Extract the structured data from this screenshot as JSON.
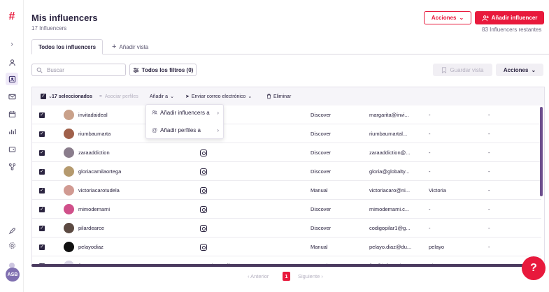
{
  "app": {
    "logo": "#"
  },
  "header": {
    "title": "Mis influencers",
    "count": "17 Influencers",
    "actions_label": "Acciones",
    "add_label": "Añadir influencer",
    "remaining": "83 Influencers restantes"
  },
  "tabs": {
    "active": "Todos los influencers",
    "add_view": "Añadir vista"
  },
  "toolbar": {
    "search_placeholder": "Buscar",
    "filters_label": "Todos los filtros (0)",
    "save_view_label": "Guardar vista",
    "actions_label": "Acciones"
  },
  "bulk": {
    "selected": "17 seleccionados",
    "associate": "Asociar perfiles",
    "add_to": "Añadir a",
    "send_email": "Enviar correo electrónico",
    "delete": "Eliminar"
  },
  "dropdown": {
    "items": [
      "Añadir influencers a",
      "Añadir perfiles a"
    ]
  },
  "rows": [
    {
      "name": "invitadaideal",
      "source": "Discover",
      "email": "margarita@invi...",
      "col6": "-",
      "col7": "-",
      "network": "none",
      "avatar": "#c9a18a"
    },
    {
      "name": "riumbaumarta",
      "source": "Discover",
      "email": "riumbaumartal...",
      "col6": "-",
      "col7": "-",
      "network": "none",
      "avatar": "#a0604a"
    },
    {
      "name": "zaraaddiction",
      "source": "Discover",
      "email": "zaraaddiction@...",
      "col6": "-",
      "col7": "-",
      "network": "instagram",
      "avatar": "#8a7d8c"
    },
    {
      "name": "gloriacamilaortega",
      "source": "Discover",
      "email": "gloria@globalty...",
      "col6": "-",
      "col7": "-",
      "network": "instagram",
      "avatar": "#b59a6e"
    },
    {
      "name": "victoriacarotudela",
      "source": "Manual",
      "email": "victoriacaro@ni...",
      "col6": "Victoria",
      "col7": "-",
      "network": "instagram",
      "avatar": "#d19a92"
    },
    {
      "name": "mimodemami",
      "source": "Discover",
      "email": "mimodemami.c...",
      "col6": "-",
      "col7": "-",
      "network": "instagram",
      "avatar": "#d0508a"
    },
    {
      "name": "pilardearce",
      "source": "Discover",
      "email": "codigopilar1@g...",
      "col6": "-",
      "col7": "-",
      "network": "instagram",
      "avatar": "#5c4a42"
    },
    {
      "name": "pelayodiaz",
      "source": "Manual",
      "email": "pelayo.diaz@du...",
      "col6": "pelayo",
      "col7": "-",
      "network": "instagram",
      "avatar": "#111111"
    },
    {
      "name": "flor",
      "source": "Manual",
      "email": "flor@influencit...",
      "col6": "Flor",
      "col7": "",
      "network": "Asociar perfiles",
      "avatar": "#d8d4e4"
    }
  ],
  "pagination": {
    "prev": "Anterior",
    "page": "1",
    "next": "Siguiente"
  },
  "user": {
    "initials": "ASB"
  },
  "colors": {
    "brand": "#e8193c",
    "dark": "#2b2440",
    "accent": "#6e4f8e"
  }
}
